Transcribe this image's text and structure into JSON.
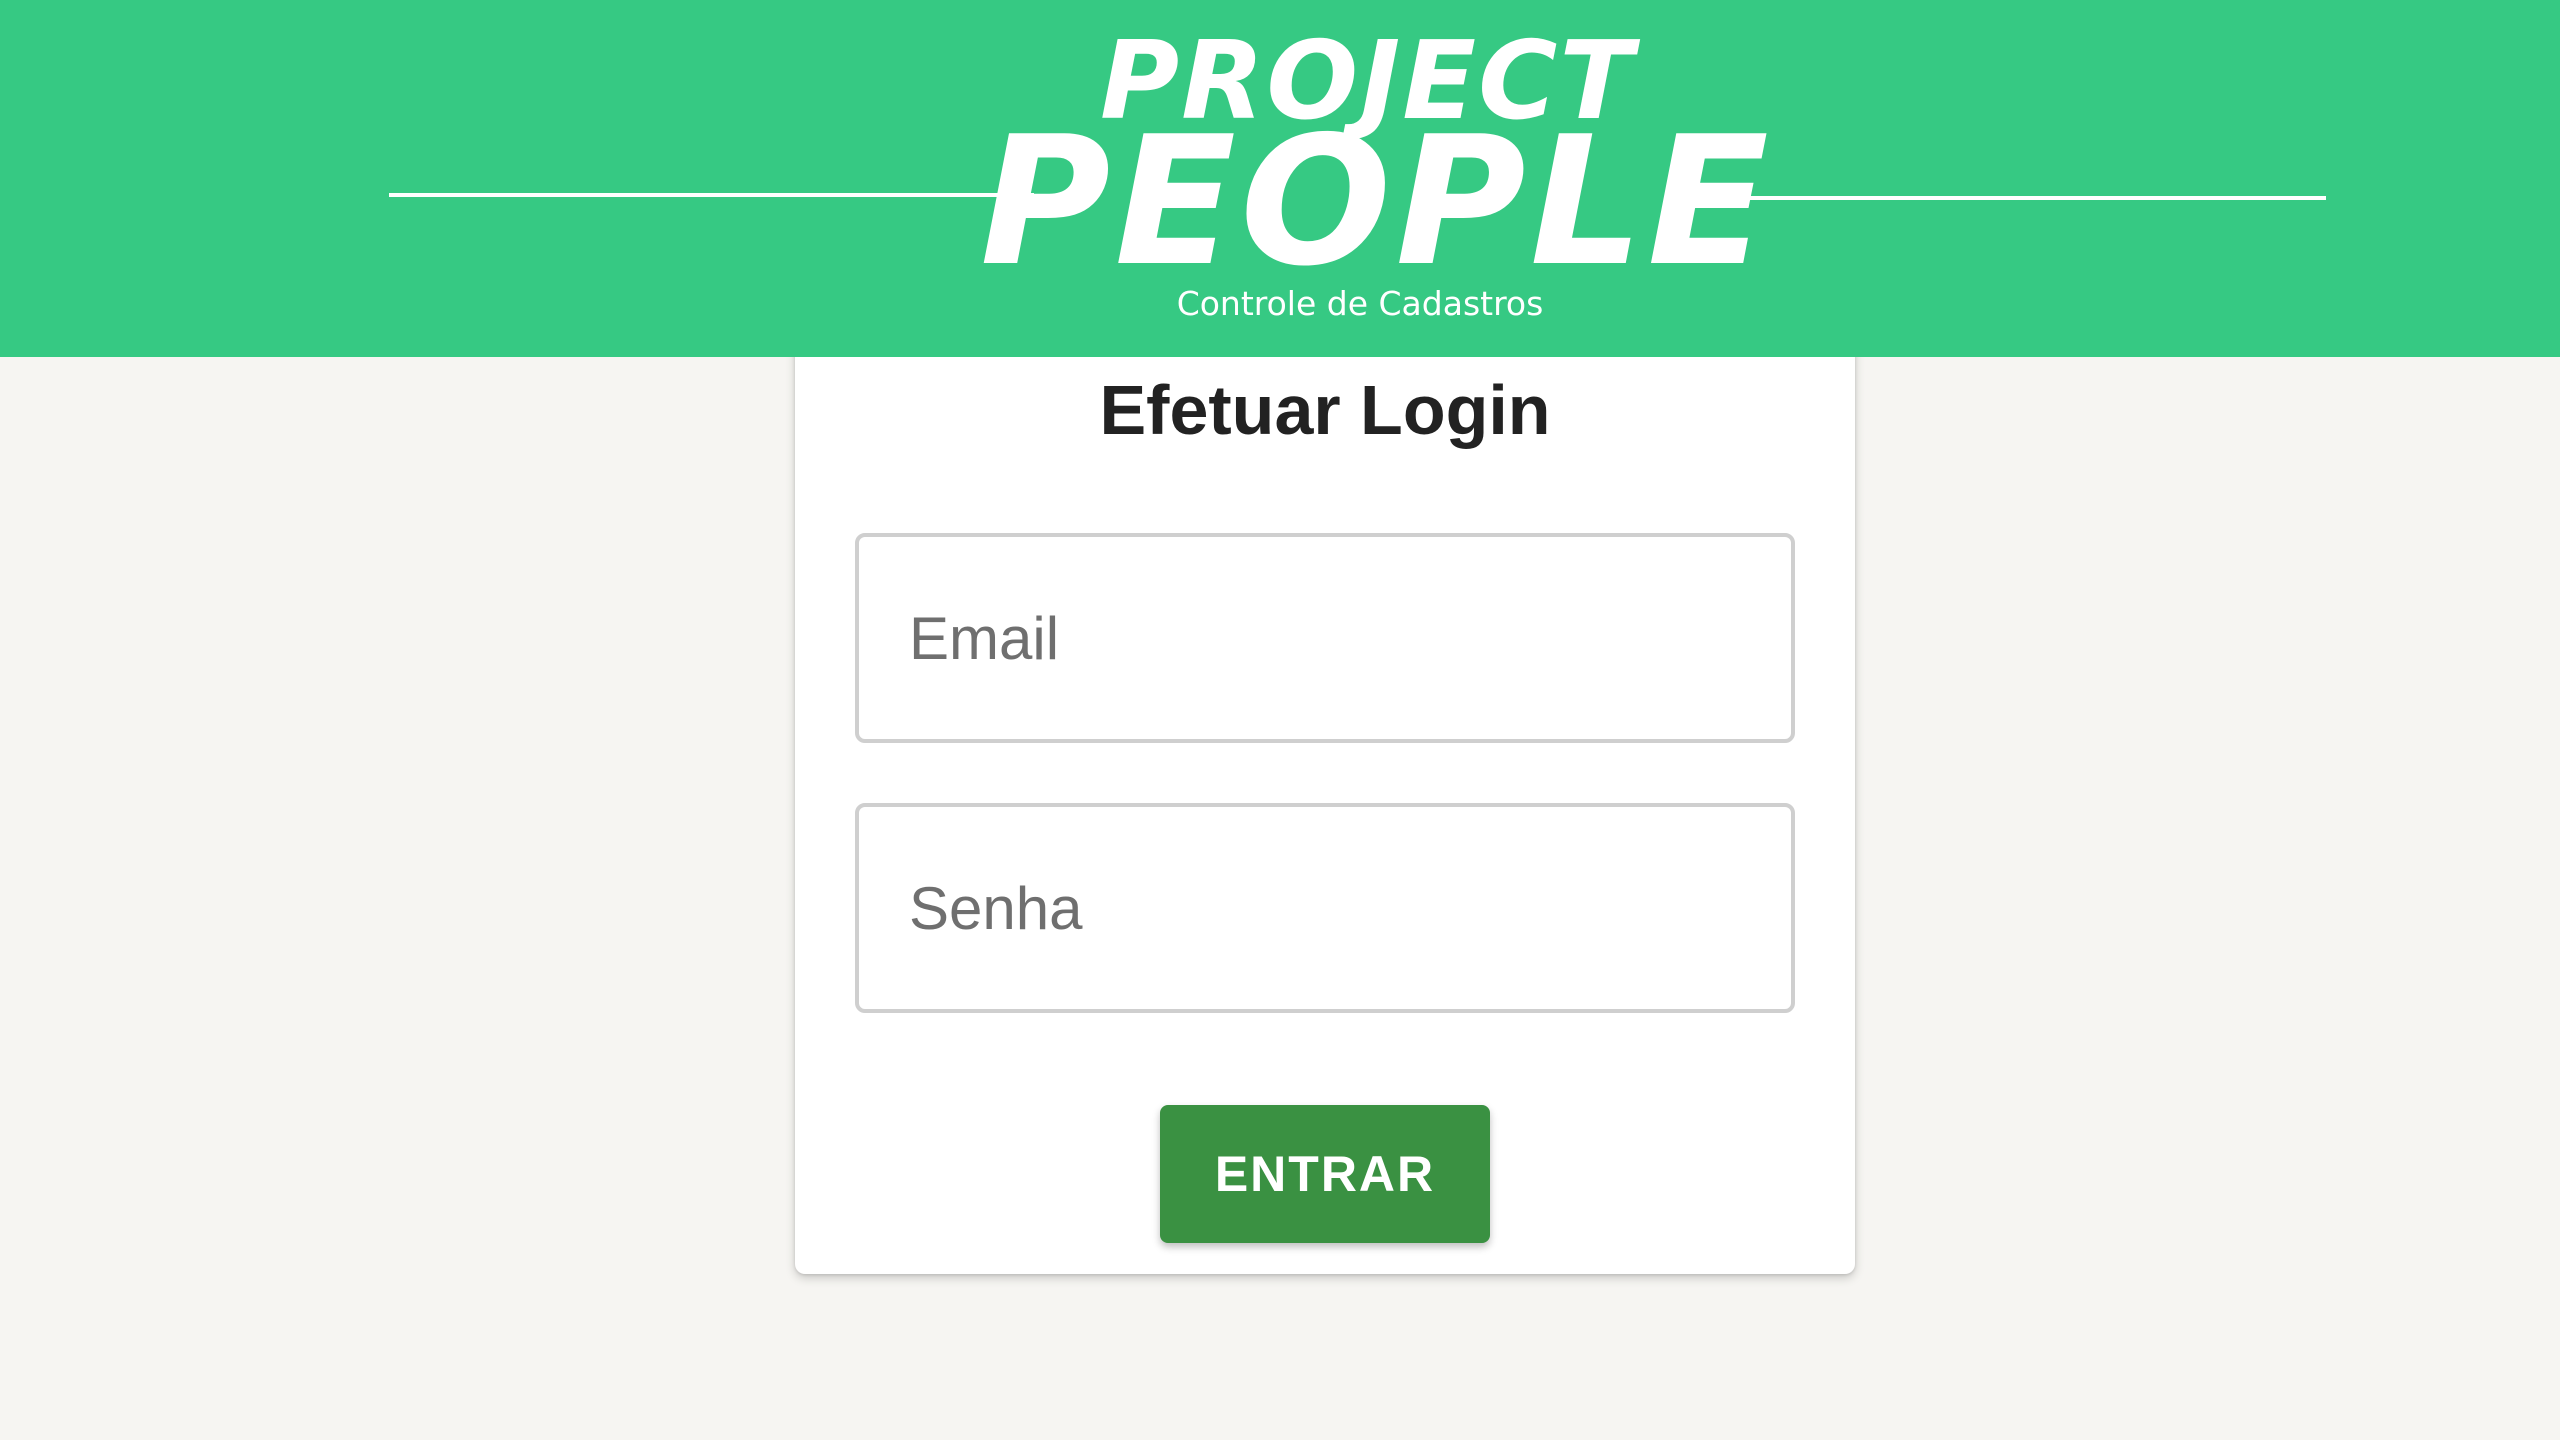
{
  "header": {
    "logo_line1": "PROJECT",
    "logo_line2": "PEOPLE",
    "subtitle": "Controle de Cadastros"
  },
  "login": {
    "title": "Efetuar Login",
    "email_placeholder": "Email",
    "email_value": "",
    "password_placeholder": "Senha",
    "password_value": "",
    "submit_label": "ENTRAR"
  },
  "colors": {
    "header_bg": "#36c983",
    "page_bg": "#f6f5f2",
    "button_bg": "#3a9142",
    "card_bg": "#ffffff",
    "title_text": "#222222"
  }
}
